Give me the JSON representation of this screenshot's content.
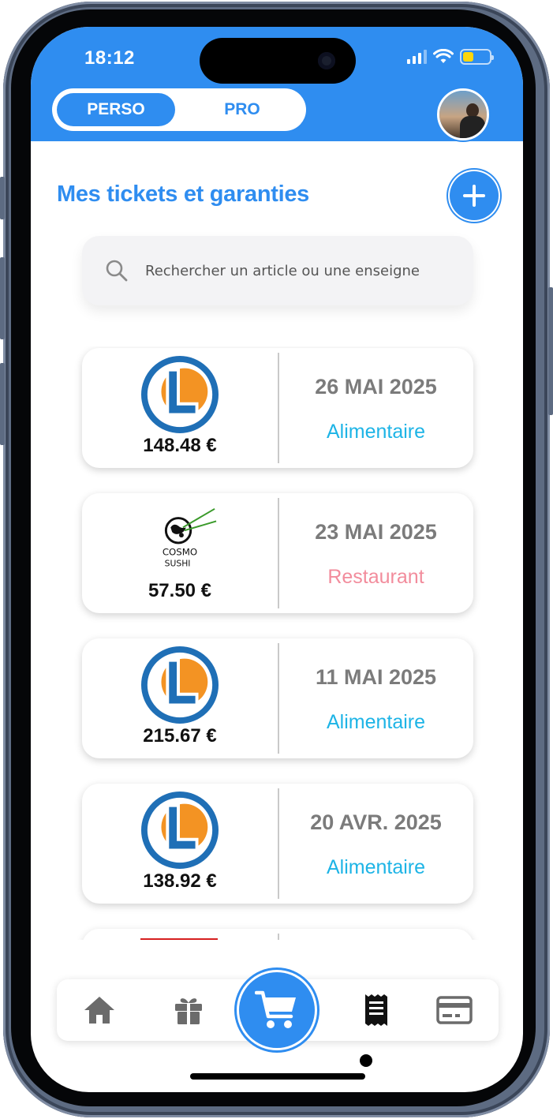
{
  "status_bar": {
    "time": "18:12"
  },
  "header": {
    "toggle": {
      "perso_label": "PERSO",
      "pro_label": "PRO",
      "active": "PERSO"
    },
    "avatar_icon": "profile-photo"
  },
  "page": {
    "title": "Mes tickets et garanties",
    "add_icon": "plus-icon"
  },
  "search": {
    "placeholder": "Rechercher un article ou une enseigne",
    "icon": "search-icon"
  },
  "tickets": [
    {
      "store": "E.Leclerc",
      "amount": "148.48 €",
      "date": "26 MAI 2025",
      "category": "Alimentaire",
      "category_color": "#1db4e6"
    },
    {
      "store": "Cosmo Sushi",
      "amount": "57.50 €",
      "date": "23 MAI 2025",
      "category": "Restaurant",
      "category_color": "#f28c9c"
    },
    {
      "store": "E.Leclerc",
      "amount": "215.67 €",
      "date": "11 MAI 2025",
      "category": "Alimentaire",
      "category_color": "#1db4e6"
    },
    {
      "store": "E.Leclerc",
      "amount": "138.92 €",
      "date": "20 AVR. 2025",
      "category": "Alimentaire",
      "category_color": "#1db4e6"
    }
  ],
  "cosmo_logo_text": {
    "line1": "COSMO",
    "line2": "SUSHI"
  },
  "tab_bar": {
    "items": [
      "home-icon",
      "gift-icon",
      "cart-icon",
      "receipt-icon",
      "card-icon"
    ],
    "active": "receipt-icon"
  },
  "colors": {
    "primary": "#2f8df0",
    "leclerc_blue": "#1f6fb6",
    "leclerc_orange": "#f39323"
  }
}
